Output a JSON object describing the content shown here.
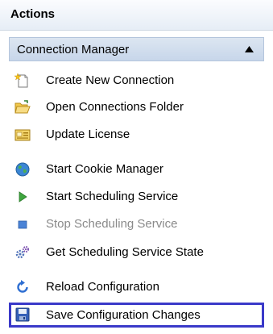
{
  "header": {
    "title": "Actions"
  },
  "section": {
    "title": "Connection Manager",
    "collapse_icon": "triangle-up-icon"
  },
  "items": [
    {
      "label": "Create New Connection",
      "icon": "new-document-icon"
    },
    {
      "label": "Open Connections Folder",
      "icon": "open-folder-icon"
    },
    {
      "label": "Update License",
      "icon": "license-icon"
    },
    {
      "label": "Start Cookie Manager",
      "icon": "globe-icon"
    },
    {
      "label": "Start Scheduling Service",
      "icon": "play-icon"
    },
    {
      "label": "Stop Scheduling Service",
      "icon": "stop-icon",
      "disabled": true
    },
    {
      "label": "Get Scheduling Service State",
      "icon": "gears-icon"
    },
    {
      "label": "Reload Configuration",
      "icon": "refresh-icon"
    },
    {
      "label": "Save Configuration Changes",
      "icon": "save-icon",
      "highlighted": true
    }
  ],
  "colors": {
    "highlight_border": "#3a39c9",
    "disabled_text": "#8a8a8a",
    "section_background": "#c7d6ea"
  }
}
